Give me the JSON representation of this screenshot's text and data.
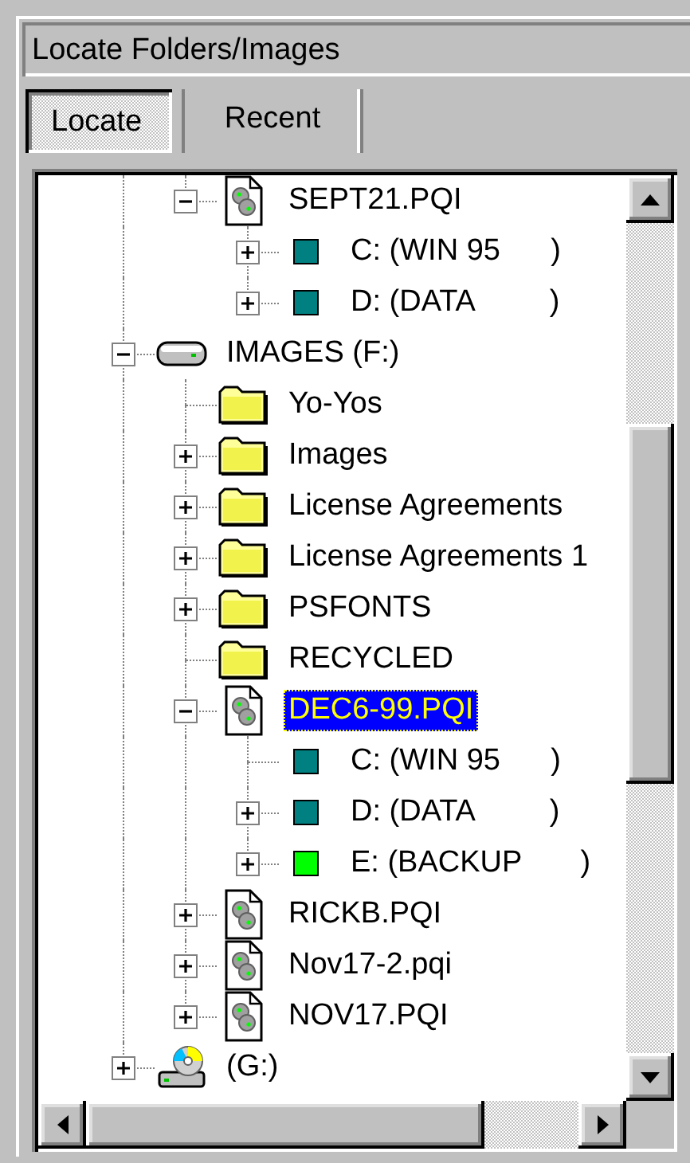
{
  "window": {
    "title": "Locate Folders/Images"
  },
  "tabs": [
    {
      "label": "Locate",
      "selected": true
    },
    {
      "label": "Recent",
      "selected": false
    }
  ],
  "tree": {
    "continued_children": [
      {
        "label": "SEPT21.PQI",
        "kind": "image-file",
        "expanded": true,
        "selected": false,
        "children": [
          {
            "label": "C: (WIN 95      )",
            "kind": "partition",
            "color": "#008080",
            "expanded": false,
            "selected": false
          },
          {
            "label": "D: (DATA         )",
            "kind": "partition",
            "color": "#008080",
            "expanded": false,
            "selected": false
          }
        ]
      }
    ],
    "nodes": [
      {
        "label": "IMAGES (F:)",
        "kind": "drive",
        "expanded": true,
        "selected": false,
        "children": [
          {
            "label": "Yo-Yos",
            "kind": "folder",
            "selected": false
          },
          {
            "label": "Images",
            "kind": "folder",
            "expanded": false,
            "selected": false
          },
          {
            "label": "License Agreements",
            "kind": "folder",
            "expanded": false,
            "selected": false
          },
          {
            "label": "License Agreements 1",
            "kind": "folder",
            "expanded": false,
            "selected": false
          },
          {
            "label": "PSFONTS",
            "kind": "folder",
            "expanded": false,
            "selected": false
          },
          {
            "label": "RECYCLED",
            "kind": "folder",
            "selected": false
          },
          {
            "label": "DEC6-99.PQI",
            "kind": "image-file",
            "expanded": true,
            "selected": true,
            "children": [
              {
                "label": "C: (WIN 95      )",
                "kind": "partition",
                "color": "#008080",
                "selected": false
              },
              {
                "label": "D: (DATA         )",
                "kind": "partition",
                "color": "#008080",
                "expanded": false,
                "selected": false
              },
              {
                "label": "E: (BACKUP       )",
                "kind": "partition",
                "color": "#00ff00",
                "expanded": false,
                "selected": false
              }
            ]
          },
          {
            "label": "RICKB.PQI",
            "kind": "image-file",
            "expanded": false,
            "selected": false
          },
          {
            "label": "Nov17-2.pqi",
            "kind": "image-file",
            "expanded": false,
            "selected": false
          },
          {
            "label": "NOV17.PQI",
            "kind": "image-file",
            "expanded": false,
            "selected": false
          }
        ]
      },
      {
        "label": "(G:)",
        "kind": "cdrom",
        "expanded": false,
        "selected": false
      }
    ]
  }
}
